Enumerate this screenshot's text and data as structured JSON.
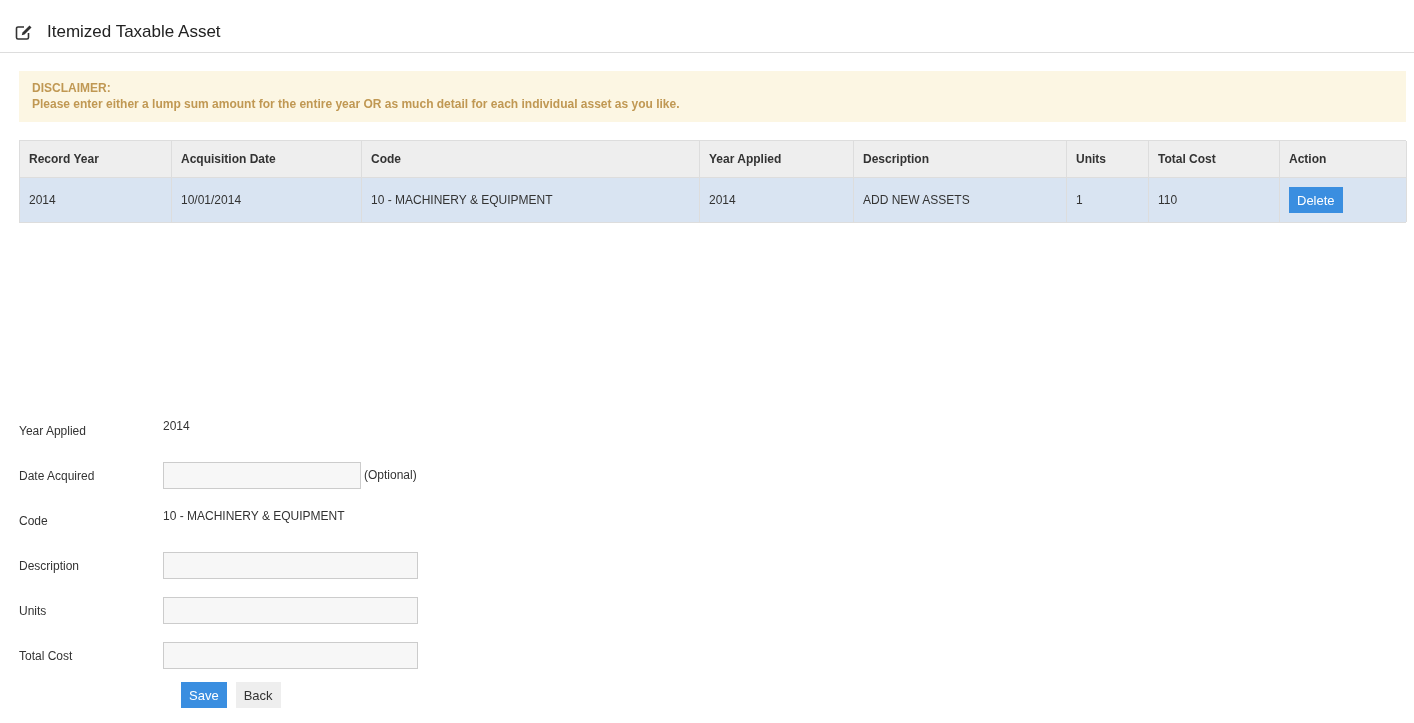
{
  "page": {
    "title": "Itemized Taxable Asset"
  },
  "disclaimer": {
    "heading": "DISCLAIMER:",
    "text": "Please enter either a lump sum amount for the entire year OR as much detail for each individual asset as you like."
  },
  "table": {
    "columns": [
      "Record Year",
      "Acquisition Date",
      "Code",
      "Year Applied",
      "Description",
      "Units",
      "Total Cost",
      "Action"
    ],
    "rows": [
      {
        "selected": true,
        "cells": [
          "2014",
          "10/01/2014",
          "10 - MACHINERY & EQUIPMENT",
          "2014",
          "ADD NEW ASSETS",
          "1",
          "110"
        ],
        "action": "Delete"
      }
    ]
  },
  "form": {
    "fields": [
      {
        "label": "Year Applied",
        "kind": "text",
        "value": "2014"
      },
      {
        "label": "Date Acquired",
        "kind": "short-input",
        "note": "(Optional)"
      },
      {
        "label": "Code",
        "kind": "text",
        "value": "10 - MACHINERY & EQUIPMENT"
      },
      {
        "label": "Description",
        "kind": "input"
      },
      {
        "label": "Units",
        "kind": "input"
      },
      {
        "label": "Total Cost",
        "kind": "input"
      }
    ],
    "buttons": [
      {
        "label": "Save",
        "kind": "primary"
      },
      {
        "label": "Back",
        "kind": "default"
      }
    ]
  }
}
